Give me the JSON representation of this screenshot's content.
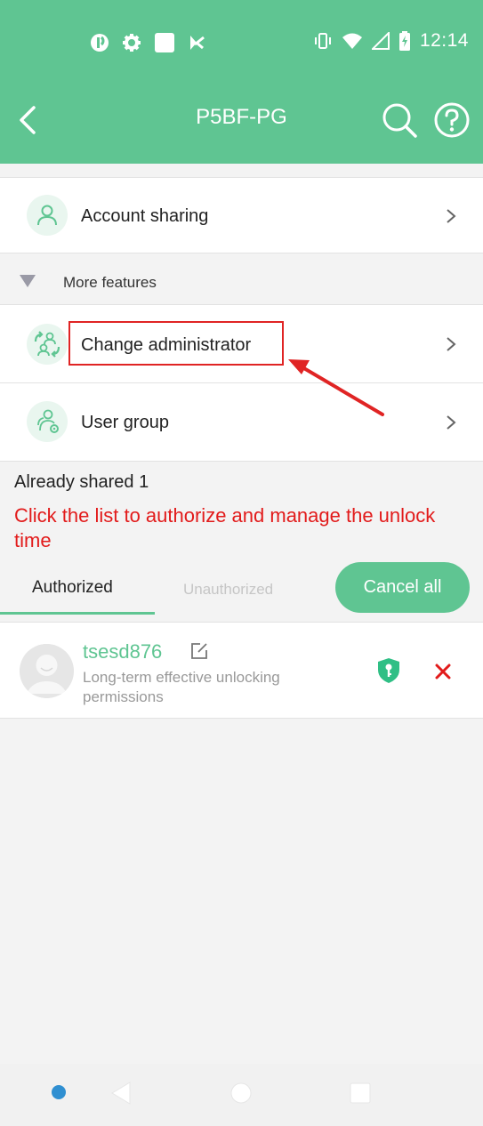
{
  "status_bar": {
    "time": "12:14",
    "left_icons": [
      "app-notification-icon",
      "gear-icon",
      "square-app-icon",
      "play-store-icon"
    ],
    "right_icons": [
      "vibrate-icon",
      "wifi-icon",
      "signal-icon",
      "battery-charging-icon"
    ]
  },
  "app_bar": {
    "title": "P5BF-PG",
    "back_icon": "back-arrow-icon",
    "search_icon": "search-icon",
    "help_icon": "help-icon"
  },
  "menu": {
    "account_sharing": "Account sharing",
    "more_features": "More features",
    "change_admin": "Change administrator",
    "user_group": "User group"
  },
  "shared": {
    "count_label": "Already shared 1",
    "hint": "Click the list to authorize and manage the unlock time"
  },
  "tabs": {
    "authorized": "Authorized",
    "unauthorized": "Unauthorized",
    "cancel_all": "Cancel all"
  },
  "users": [
    {
      "name": "tsesd876",
      "permission": "Long-term effective unlocking permissions"
    }
  ],
  "colors": {
    "brand_green": "#5fc592",
    "annotation_red": "#e02424",
    "hint_red": "#e21b1b"
  }
}
